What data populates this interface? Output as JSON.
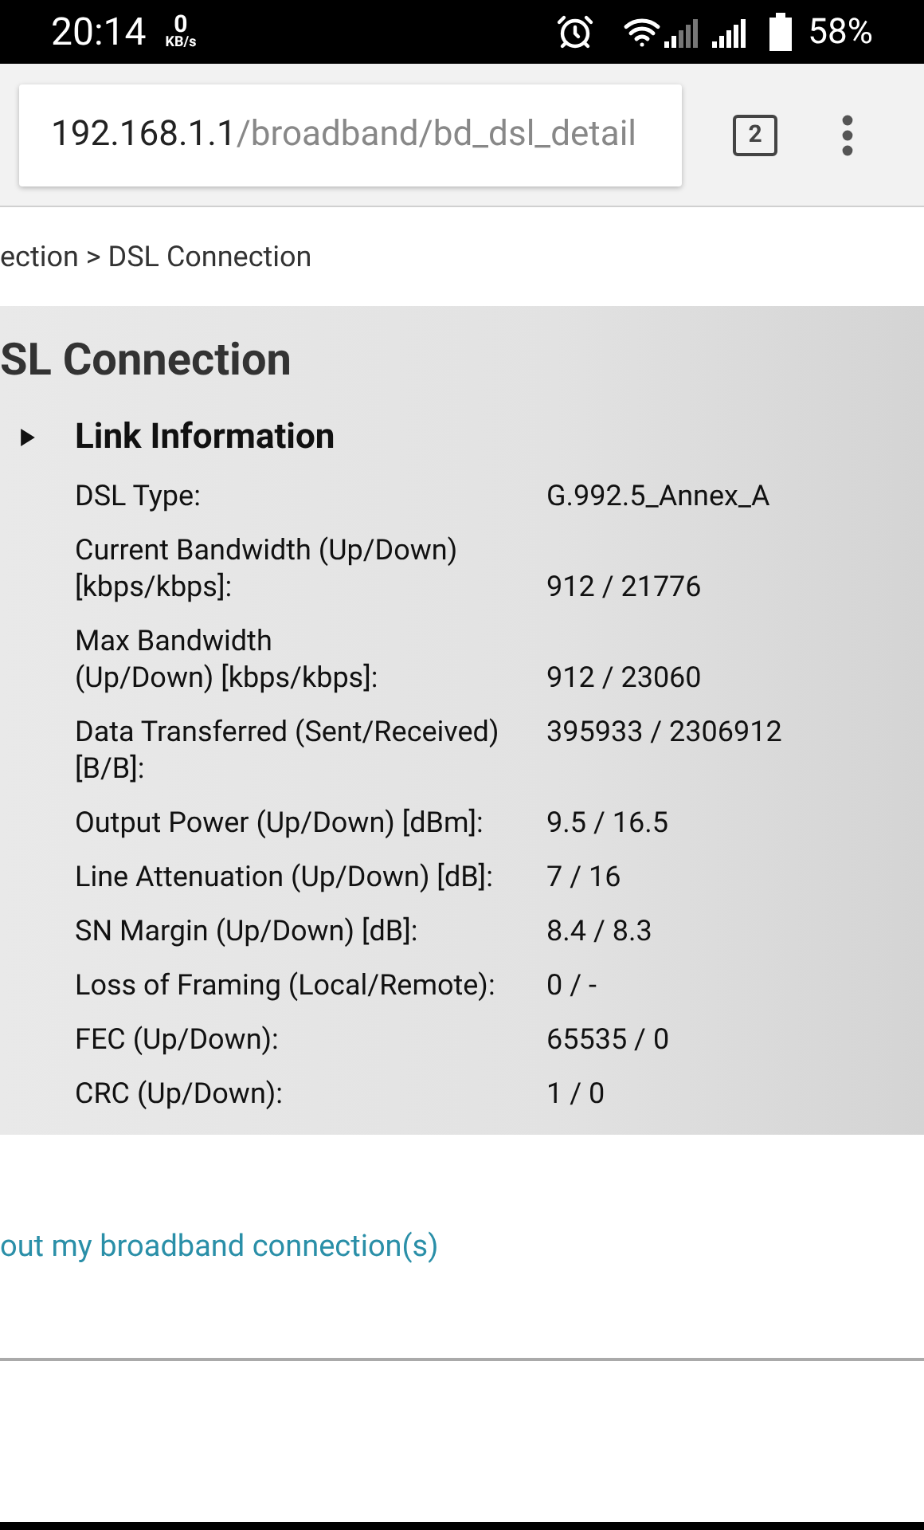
{
  "status_bar": {
    "time": "20:14",
    "speed_value": "0",
    "speed_unit": "KB/s",
    "battery": "58%"
  },
  "browser": {
    "url_host": "192.168.1.1",
    "url_path": "/broadband/bd_dsl_detail",
    "tab_count": "2"
  },
  "breadcrumb": "ection > DSL Connection",
  "panel": {
    "title": "SL Connection",
    "section": {
      "title": "Link Information",
      "expanded": false
    },
    "rows": [
      {
        "kind": "plain",
        "label": "DSL Type:",
        "value": "G.992.5_Annex_A"
      },
      {
        "kind": "trailing",
        "label": "Current Bandwidth (Up/Down)\n[kbps/kbps]:",
        "value": "912 / 21776"
      },
      {
        "kind": "trailing",
        "label": "Max Bandwidth\n(Up/Down) [kbps/kbps]:",
        "value": "912 / 23060"
      },
      {
        "kind": "plain",
        "label": "Data Transferred (Sent/Received)\n[B/B]:",
        "value": "395933 / 2306912"
      },
      {
        "kind": "plain",
        "label": "Output Power (Up/Down) [dBm]:",
        "value": "9.5 / 16.5"
      },
      {
        "kind": "plain",
        "label": "Line Attenuation (Up/Down) [dB]:",
        "value": "7 / 16"
      },
      {
        "kind": "plain",
        "label": "SN Margin (Up/Down) [dB]:",
        "value": "8.4 / 8.3"
      },
      {
        "kind": "plain",
        "label": "Loss of Framing (Local/Remote):",
        "value": "0 / -"
      },
      {
        "kind": "plain",
        "label": "FEC (Up/Down):",
        "value": "65535 / 0"
      },
      {
        "kind": "plain",
        "label": "CRC (Up/Down):",
        "value": "1 / 0"
      }
    ]
  },
  "link": "out my broadband connection(s)"
}
